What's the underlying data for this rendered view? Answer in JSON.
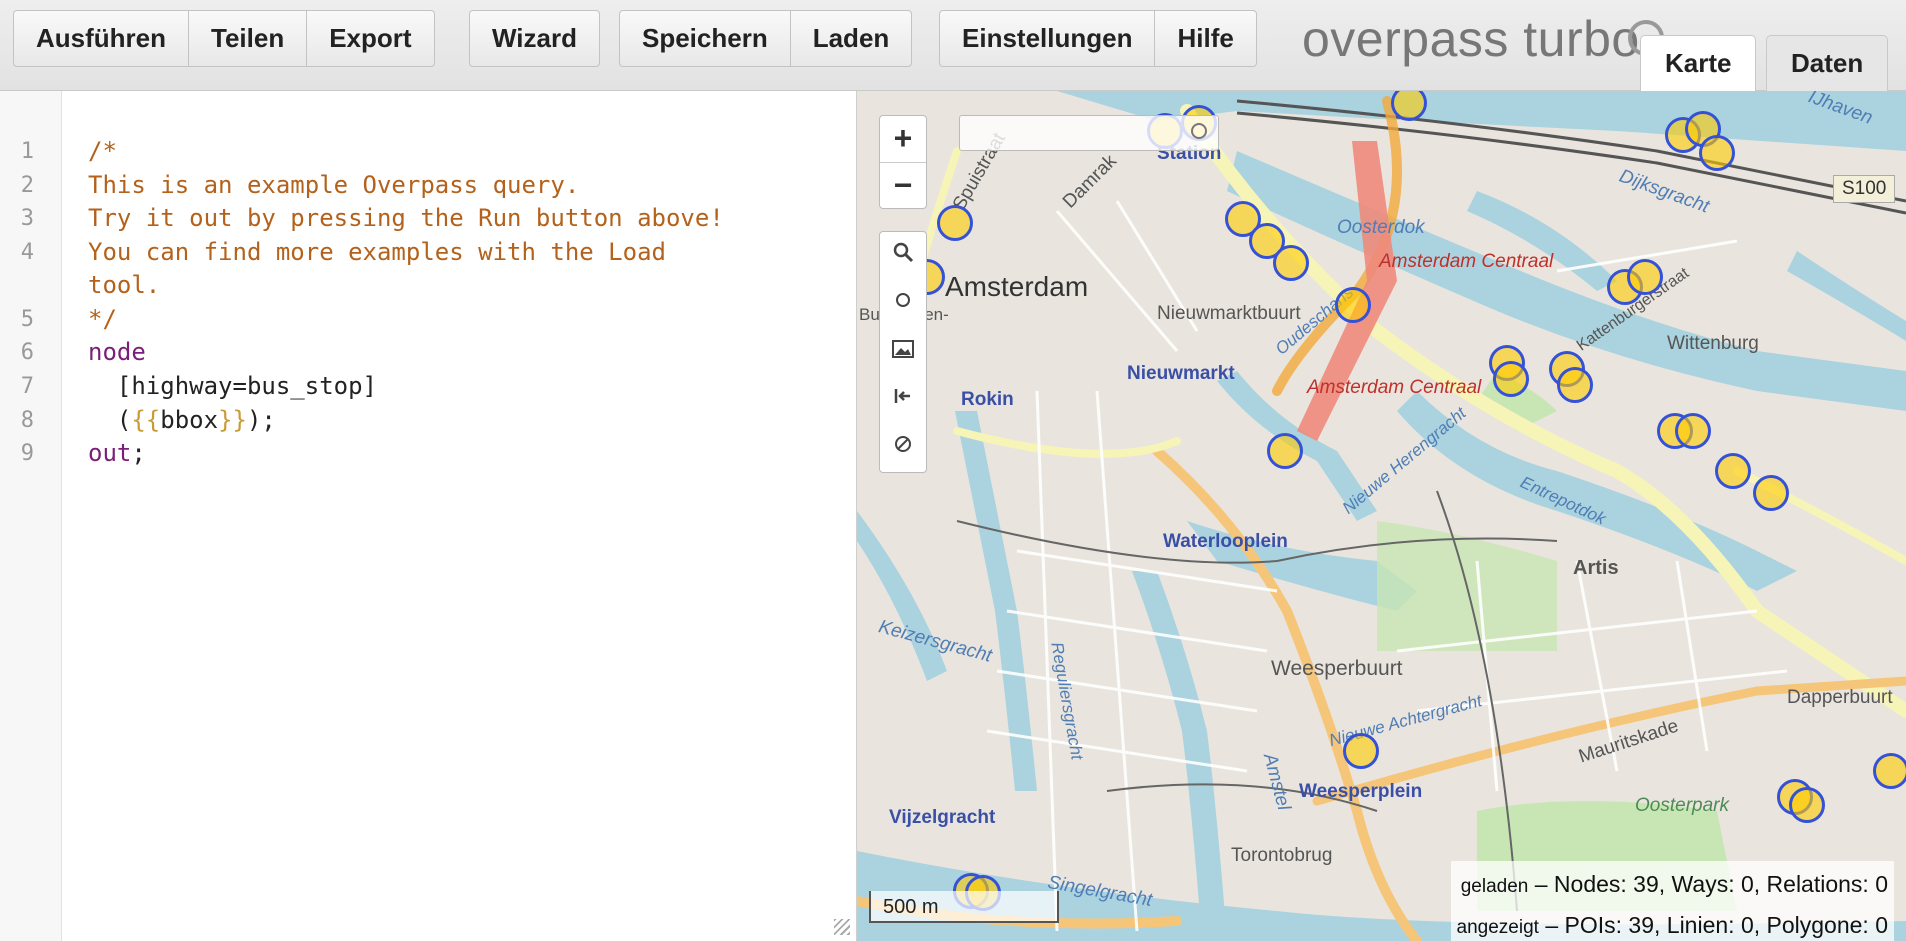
{
  "toolbar": {
    "groups": [
      [
        "Ausführen",
        "Teilen",
        "Export"
      ],
      [
        "Wizard"
      ],
      [
        "Speichern",
        "Laden"
      ],
      [
        "Einstellungen",
        "Hilfe"
      ]
    ],
    "run": "Ausführen",
    "share": "Teilen",
    "export": "Export",
    "wizard": "Wizard",
    "save": "Speichern",
    "load": "Laden",
    "settings": "Einstellungen",
    "help": "Hilfe"
  },
  "app": {
    "title": "overpass turbo"
  },
  "tabs": {
    "map": "Karte",
    "data": "Daten",
    "active": "map"
  },
  "editor": {
    "line_numbers": [
      "1",
      "2",
      "3",
      "4",
      "",
      "5",
      "6",
      "7",
      "8",
      "9"
    ],
    "lines": {
      "l1": "/*",
      "l2": "This is an example Overpass query.",
      "l3": "Try it out by pressing the Run button above!",
      "l4a": "You can find more examples with the Load",
      "l4b": "tool.",
      "l5": "*/",
      "l6": "node",
      "l7": "  [highway=bus_stop]",
      "l8_open": "  (",
      "l8_br1": "{{",
      "l8_mid": "bbox",
      "l8_br2": "}}",
      "l8_close": ");",
      "l9_kw": "out",
      "l9_end": ";"
    }
  },
  "map": {
    "labels": {
      "amsterdam": "Amsterdam",
      "station": "Station",
      "spuistraat": "Spuistraat",
      "damrak": "Damrak",
      "oosterdok": "Oosterdok",
      "centraal1": "Amsterdam Centraal",
      "centraal2": "Amsterdam Centraal",
      "nieuwmarktbuurt": "Nieuwmarktbuurt",
      "nieuwmarkt": "Nieuwmarkt",
      "rokin": "Rokin",
      "wittenburg": "Wittenburg",
      "kattenburgerstraat": "Kattenburgerstraat",
      "dijksgracht": "Dijksgracht",
      "ijhaven": "IJhaven",
      "s100": "S100",
      "waterlooplein": "Waterlooplein",
      "artis": "Artis",
      "entrepotdok": "Entrepotdok",
      "weesperbuurt": "Weesperbuurt",
      "weesperplein": "Weesperplein",
      "nieuweachtergracht": "Nieuwe Achtergracht",
      "mauritskade": "Mauritskade",
      "dapperbuurt": "Dapperbuurt",
      "oosterpark": "Oosterpark",
      "vijzelgracht": "Vijzelgracht",
      "torontobrug": "Torontobrug",
      "singelgracht": "Singelgracht",
      "amstel": "Amstel",
      "keizersgracht": "Keizersgracht",
      "reguliersgracht": "Reguliersgracht",
      "herengracht": "Nieuwe Herengracht",
      "oudeschans": "Oudeschans",
      "burgwallen": "Burgwallen-"
    },
    "search_placeholder": "",
    "scale": "500 m",
    "stats": {
      "loaded_key": "geladen",
      "loaded_text": "– Nodes: 39, Ways: 0, Relations: 0",
      "shown_key": "angezeigt",
      "shown_text": "– POIs: 39, Linien: 0, Polygone: 0"
    },
    "controls": {
      "zoom_in": "+",
      "zoom_out": "−"
    }
  }
}
